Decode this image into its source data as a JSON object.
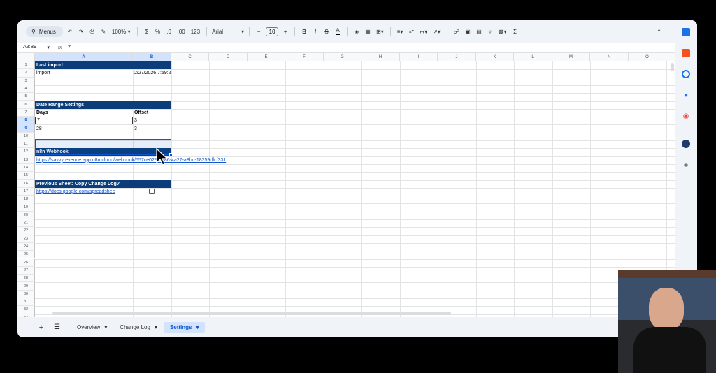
{
  "toolbar": {
    "search_label": "Menus",
    "zoom": "100%",
    "currency": "$",
    "percent": "%",
    "dec_decrease": ".0",
    "dec_increase": ".00",
    "number_format": "123",
    "font": "Arial",
    "font_size": "10",
    "bold": "B",
    "italic": "I",
    "strike": "S",
    "text_color": "A",
    "function": "Σ"
  },
  "formula_bar": {
    "name_box": "A8:B9",
    "fx": "fx",
    "value": "7"
  },
  "columns": [
    "A",
    "B",
    "C",
    "D",
    "E",
    "F",
    "G",
    "H",
    "I",
    "J",
    "K",
    "L",
    "M",
    "N",
    "O",
    "P"
  ],
  "rows": [
    "1",
    "2",
    "3",
    "4",
    "5",
    "6",
    "7",
    "8",
    "9",
    "10",
    "11",
    "12",
    "13",
    "14",
    "15",
    "16",
    "17",
    "18",
    "19",
    "20",
    "21",
    "22",
    "23",
    "24",
    "25",
    "26",
    "27",
    "28",
    "29",
    "30",
    "31",
    "32",
    "33"
  ],
  "cells": {
    "a1": "Last import",
    "a2": "import",
    "b2": "2/27/2026 7:59:2",
    "a6": "Date Range Settings",
    "a7": "Days",
    "b7": "Offset",
    "a8": "7",
    "b8": "3",
    "a9": "28",
    "b9": "3",
    "a12": "n8n Webhook",
    "a13": "https://savvyrevenue.app.n8n.cloud/webhook/557ce023-aa86-4a27-a8bd-18259dfcf331",
    "a16": "Previous Sheet: Copy Change Log?",
    "a17": "https://docs.google.com/spreadshee"
  },
  "tabs": [
    {
      "label": "Overview"
    },
    {
      "label": "Change Log"
    },
    {
      "label": "Settings"
    }
  ],
  "colors": {
    "header_fill": "#0b3d7a",
    "selection": "#d3e3fd",
    "accent": "#0b57d0"
  }
}
